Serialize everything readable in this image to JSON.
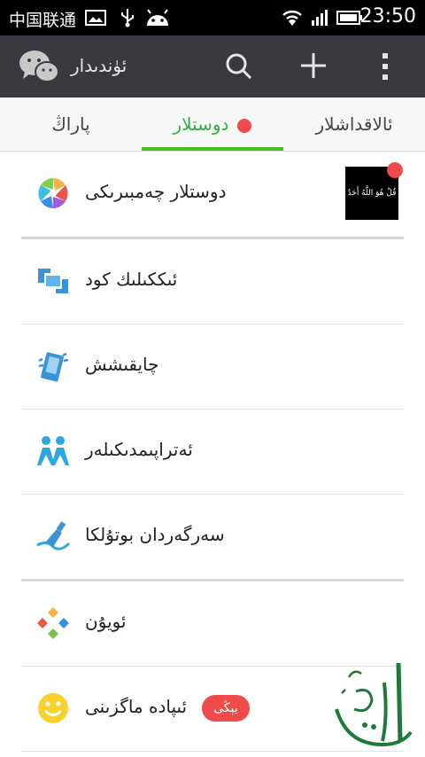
{
  "status": {
    "carrier": "中国联通",
    "time": "23:50"
  },
  "appbar": {
    "title": "ئۈندىدار"
  },
  "tabs": [
    {
      "label": "ئالاقداشلار",
      "active": false
    },
    {
      "label": "دوستلار",
      "active": true,
      "has_dot": true
    },
    {
      "label": "پاراڭ",
      "active": false
    }
  ],
  "list": {
    "moments": {
      "label": "دوستلار چەمبىرىكى",
      "thumb_text": "قُلْ هُوَ اللَّهُ أَحَدٌ"
    },
    "scan": {
      "label": "ئىككىلىك كود"
    },
    "shake": {
      "label": "چايقىشش"
    },
    "nearby": {
      "label": "ئەتراپىمدىكىلەر"
    },
    "bottle": {
      "label": "سەرگەردان بوتۇلكا"
    },
    "games": {
      "label": "ئويۇن"
    },
    "expression": {
      "label": "ئىپادە ماگزىنى",
      "badge": "يېڭى"
    }
  },
  "watermark": {
    "text": "ئاليۇتۇرى"
  },
  "colors": {
    "status_bar": "#000000",
    "app_bar": "#393a3f",
    "accent_green": "#46c01b",
    "active_tab_text": "#2fb13f",
    "red_dot": "#f04b4b"
  }
}
